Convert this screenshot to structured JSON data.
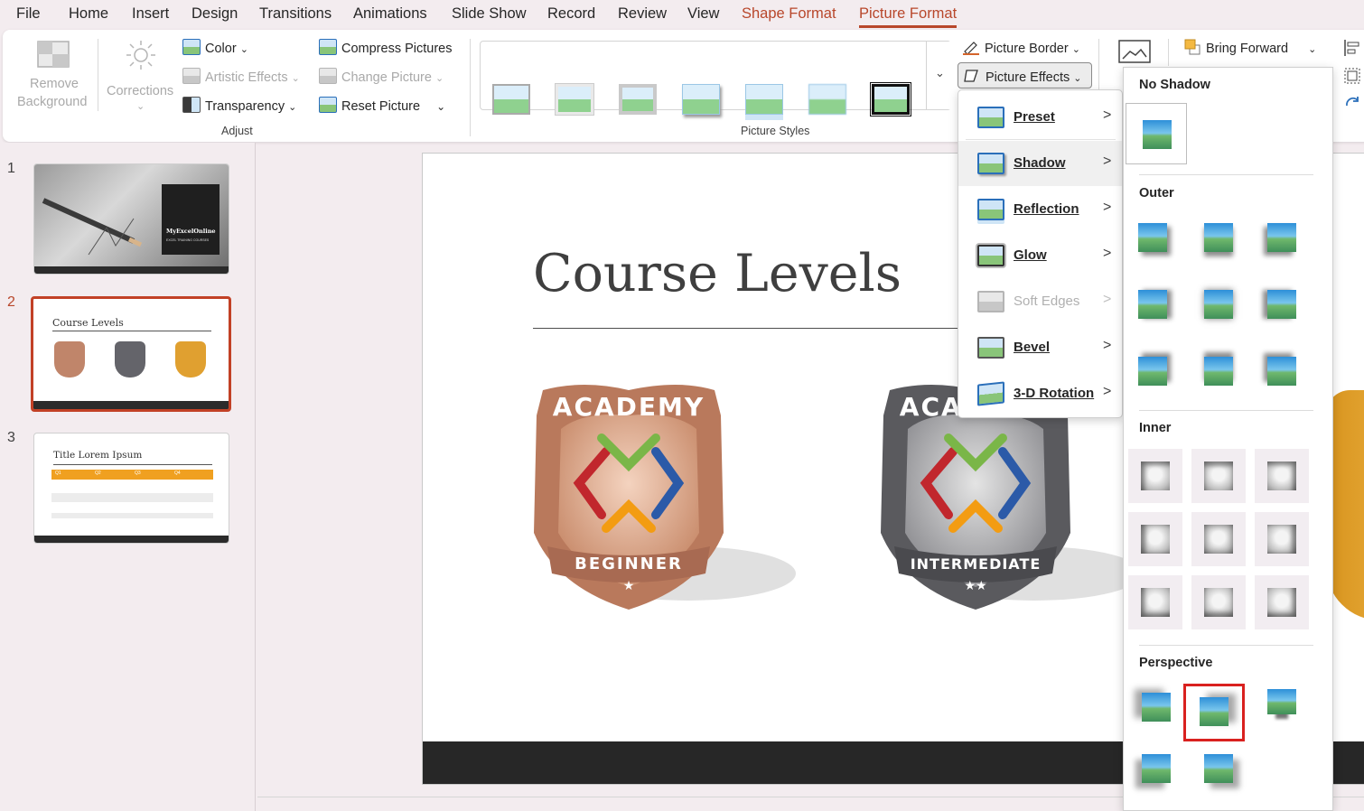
{
  "menubar": {
    "tabs": [
      "File",
      "Home",
      "Insert",
      "Design",
      "Transitions",
      "Animations",
      "Slide Show",
      "Record",
      "Review",
      "View",
      "Shape Format",
      "Picture Format"
    ]
  },
  "ribbon": {
    "adjust": {
      "remove_background_1": "Remove",
      "remove_background_2": "Background",
      "corrections": "Corrections",
      "color": "Color",
      "artistic_effects": "Artistic Effects",
      "transparency": "Transparency",
      "compress_pictures": "Compress Pictures",
      "change_picture": "Change Picture",
      "reset_picture": "Reset Picture",
      "group_label": "Adjust"
    },
    "picture_styles": {
      "group_label": "Picture Styles",
      "picture_border": "Picture Border",
      "picture_effects": "Picture Effects"
    },
    "arrange": {
      "bring_forward": "Bring Forward"
    }
  },
  "slides": {
    "numbers": [
      "1",
      "2",
      "3"
    ],
    "thumb1_title": "MyExcelOnline",
    "thumb1_sub": "EXCEL TRAINING COURSES",
    "thumb2_title": "Course Levels",
    "thumb3_title": "Title Lorem Ipsum",
    "thumb3_headers": [
      "Q1",
      "Q2",
      "Q3",
      "Q4"
    ]
  },
  "slide": {
    "title": "Course Levels",
    "badges": [
      {
        "top": "ACADEMY",
        "bottom": "BEGINNER",
        "stars": "★",
        "color": "#b97a5e"
      },
      {
        "top": "ACADEMY",
        "bottom": "INTERMEDIATE",
        "stars": "★★",
        "color": "#5c5c60"
      }
    ]
  },
  "effects_menu": {
    "items": [
      "Preset",
      "Shadow",
      "Reflection",
      "Glow",
      "Soft Edges",
      "Bevel",
      "3-D Rotation"
    ]
  },
  "shadow_gallery": {
    "sections": [
      "No Shadow",
      "Outer",
      "Inner",
      "Perspective"
    ]
  },
  "colors": {
    "accent": "#b8472b",
    "highlight_box": "#d9211f"
  }
}
